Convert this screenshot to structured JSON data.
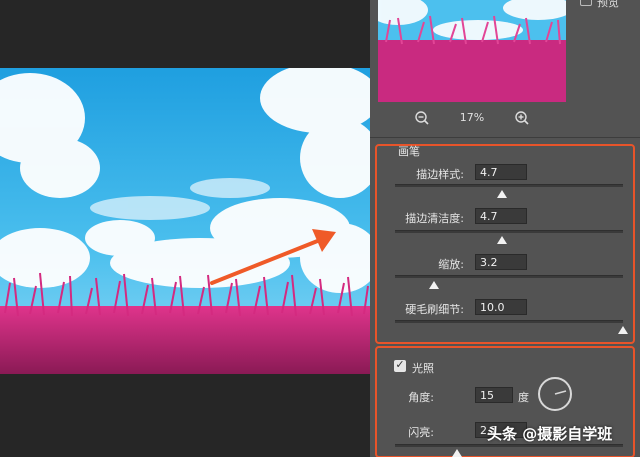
{
  "preview": {
    "label": "预览",
    "zoom_value": "17%"
  },
  "brush": {
    "title": "画笔",
    "params": [
      {
        "label": "描边样式:",
        "value": "4.7",
        "fraction": 0.47
      },
      {
        "label": "描边清洁度:",
        "value": "4.7",
        "fraction": 0.47
      },
      {
        "label": "缩放:",
        "value": "3.2",
        "fraction": 0.17
      },
      {
        "label": "硬毛刷细节:",
        "value": "10.0",
        "fraction": 1.0
      }
    ]
  },
  "lighting": {
    "title": "光照",
    "checked": true,
    "angle_label": "角度:",
    "angle_value": "15",
    "angle_unit": "度",
    "shine_label": "闪亮:",
    "shine_value": "2.7"
  },
  "watermark": "头条 @摄影自学班",
  "colors": {
    "accent": "#e8542a",
    "panel_bg": "#535353",
    "canvas_bg": "#262626"
  },
  "icons": {
    "zoom_out": "zoom-out-icon",
    "zoom_in": "zoom-in-icon",
    "check": "check-icon"
  }
}
